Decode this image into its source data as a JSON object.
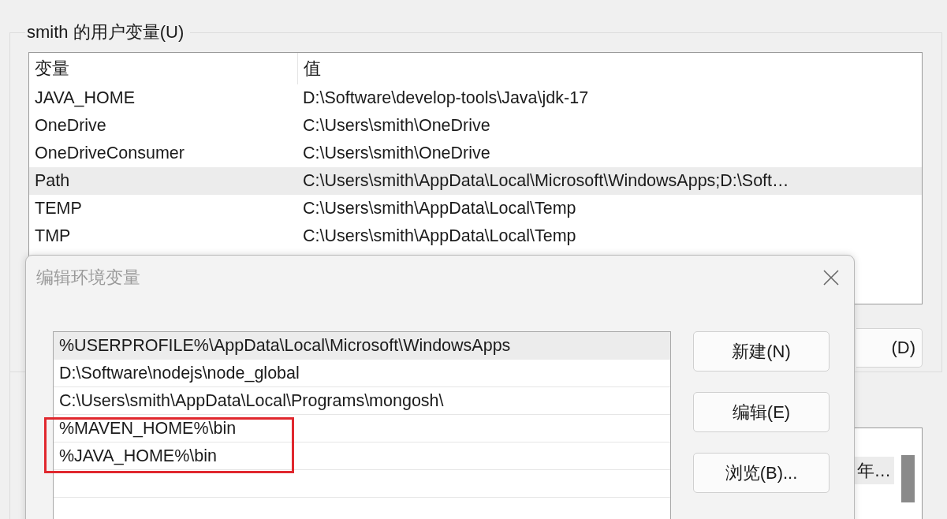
{
  "user_variables": {
    "title": "smith 的用户变量(U)",
    "columns": [
      "变量",
      "值"
    ],
    "rows": [
      {
        "name": "JAVA_HOME",
        "value": "D:\\Software\\develop-tools\\Java\\jdk-17",
        "selected": false
      },
      {
        "name": "OneDrive",
        "value": "C:\\Users\\smith\\OneDrive",
        "selected": false
      },
      {
        "name": "OneDriveConsumer",
        "value": "C:\\Users\\smith\\OneDrive",
        "selected": false
      },
      {
        "name": "Path",
        "value": "C:\\Users\\smith\\AppData\\Local\\Microsoft\\WindowsApps;D:\\Soft…",
        "selected": true
      },
      {
        "name": "TEMP",
        "value": "C:\\Users\\smith\\AppData\\Local\\Temp",
        "selected": false
      },
      {
        "name": "TMP",
        "value": "C:\\Users\\smith\\AppData\\Local\\Temp",
        "selected": false
      }
    ],
    "partial_button": "(D)"
  },
  "system_variables": {
    "rows": [
      {
        "value": "年…",
        "selected": true
      }
    ]
  },
  "dialog": {
    "title": "编辑环境变量",
    "entries": [
      {
        "text": "%USERPROFILE%\\AppData\\Local\\Microsoft\\WindowsApps",
        "selected": true,
        "highlighted": false
      },
      {
        "text": "D:\\Software\\nodejs\\node_global",
        "selected": false,
        "highlighted": false
      },
      {
        "text": "C:\\Users\\smith\\AppData\\Local\\Programs\\mongosh\\",
        "selected": false,
        "highlighted": false
      },
      {
        "text": "%MAVEN_HOME%\\bin",
        "selected": false,
        "highlighted": true
      },
      {
        "text": "%JAVA_HOME%\\bin",
        "selected": false,
        "highlighted": true
      }
    ],
    "buttons": [
      "新建(N)",
      "编辑(E)",
      "浏览(B)..."
    ]
  }
}
